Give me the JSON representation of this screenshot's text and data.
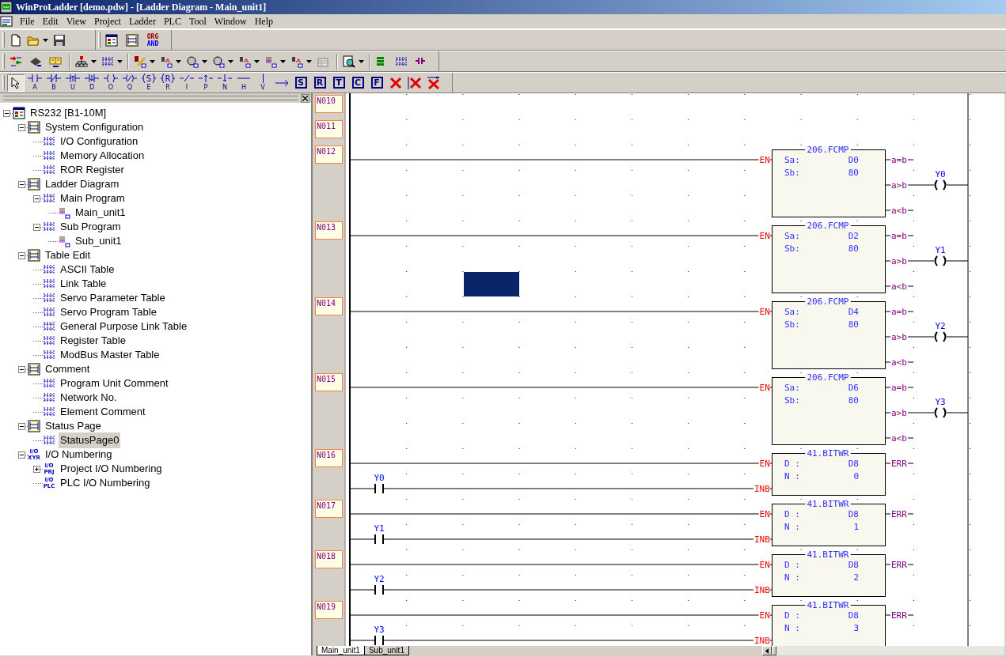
{
  "window": {
    "title": "WinProLadder [demo.pdw] - [Ladder Diagram - Main_unit1]"
  },
  "menu": [
    "File",
    "Edit",
    "View",
    "Project",
    "Ladder",
    "PLC",
    "Tool",
    "Window",
    "Help"
  ],
  "toolbar": {
    "org_and": [
      "ORG",
      "AND"
    ]
  },
  "ladder_tools": [
    {
      "kind": "pointer",
      "selected": true
    },
    {
      "kind": "contact",
      "key": "A",
      "selected": false
    },
    {
      "kind": "contact-nc",
      "key": "B",
      "selected": false
    },
    {
      "kind": "contact-up",
      "key": "U",
      "selected": false
    },
    {
      "kind": "contact-down",
      "key": "D",
      "selected": false
    },
    {
      "kind": "coil",
      "key": "O",
      "selected": false
    },
    {
      "kind": "coil-neg",
      "key": "Q",
      "selected": false
    },
    {
      "kind": "coil-letter",
      "inner": "S",
      "key": "E",
      "selected": false
    },
    {
      "kind": "coil-letter",
      "inner": "R",
      "key": "R",
      "selected": false
    },
    {
      "kind": "invert",
      "key": "I",
      "selected": false
    },
    {
      "kind": "up",
      "key": "P",
      "selected": false
    },
    {
      "kind": "down",
      "key": "N",
      "selected": false
    },
    {
      "kind": "hline",
      "key": "H",
      "selected": false
    },
    {
      "kind": "vline",
      "key": "V",
      "selected": false
    },
    {
      "kind": "arrow",
      "selected": false
    },
    {
      "kind": "boxed",
      "label": "S",
      "selected": false
    },
    {
      "kind": "boxed",
      "label": "R",
      "selected": false
    },
    {
      "kind": "boxed",
      "label": "T",
      "selected": false
    },
    {
      "kind": "boxed",
      "label": "C",
      "selected": false
    },
    {
      "kind": "boxed",
      "label": "F",
      "selected": false
    },
    {
      "kind": "delete",
      "selected": false
    },
    {
      "kind": "delete-v",
      "selected": false
    },
    {
      "kind": "delete-h",
      "selected": false
    }
  ],
  "tree": [
    {
      "label": "RS232 [B1-10M]",
      "expanded": true,
      "selected": false,
      "children": [
        {
          "label": "System Configuration",
          "expanded": true,
          "selected": false,
          "children": [
            {
              "label": "I/O Configuration",
              "selected": false
            },
            {
              "label": "Memory Allocation",
              "selected": false
            },
            {
              "label": "ROR Register",
              "selected": false
            }
          ]
        },
        {
          "label": "Ladder Diagram",
          "expanded": true,
          "selected": false,
          "children": [
            {
              "label": "Main Program",
              "expanded": true,
              "selected": false,
              "children": [
                {
                  "label": "Main_unit1",
                  "selected": false
                }
              ]
            },
            {
              "label": "Sub Program",
              "expanded": true,
              "selected": false,
              "children": [
                {
                  "label": "Sub_unit1",
                  "selected": false
                }
              ]
            }
          ]
        },
        {
          "label": "Table Edit",
          "expanded": true,
          "selected": false,
          "children": [
            {
              "label": "ASCII Table",
              "selected": false
            },
            {
              "label": "Link Table",
              "selected": false
            },
            {
              "label": "Servo Parameter Table",
              "selected": false
            },
            {
              "label": "Servo Program Table",
              "selected": false
            },
            {
              "label": "General Purpose Link Table",
              "selected": false
            },
            {
              "label": "Register Table",
              "selected": false
            },
            {
              "label": "ModBus Master Table",
              "selected": false
            }
          ]
        },
        {
          "label": "Comment",
          "expanded": true,
          "selected": false,
          "children": [
            {
              "label": "Program Unit Comment",
              "selected": false
            },
            {
              "label": "Network No.",
              "selected": false
            },
            {
              "label": "Element Comment",
              "selected": false
            }
          ]
        },
        {
          "label": "Status Page",
          "expanded": true,
          "selected": false,
          "children": [
            {
              "label": "StatusPage0",
              "selected": true
            }
          ]
        },
        {
          "label": "I/O Numbering",
          "badge": [
            "I/O",
            "XYR"
          ],
          "expanded": true,
          "selected": false,
          "children": [
            {
              "label": "Project I/O Numbering",
              "badge": [
                "I/O",
                "PRJ"
              ],
              "expanded": false,
              "selected": false
            },
            {
              "label": "PLC I/O Numbering",
              "badge": [
                "I/O",
                "PLC"
              ],
              "selected": false
            }
          ]
        }
      ]
    }
  ],
  "ladder": {
    "selection": true,
    "networks": [
      {
        "label": "N010",
        "kind": "empty"
      },
      {
        "label": "N011",
        "kind": "empty"
      },
      {
        "label": "N012",
        "kind": "block",
        "block": "206.FCMP",
        "inputs": [
          {
            "pin": "EN"
          }
        ],
        "operands": [
          {
            "name": "Sa:",
            "value": "D0"
          },
          {
            "name": "Sb:",
            "value": "80"
          }
        ],
        "outputs": [
          {
            "label": "a=b"
          },
          {
            "label": "a>b",
            "coil": "Y0"
          },
          {
            "label": "a<b"
          }
        ]
      },
      {
        "label": "N013",
        "kind": "block",
        "block": "206.FCMP",
        "inputs": [
          {
            "pin": "EN"
          }
        ],
        "operands": [
          {
            "name": "Sa:",
            "value": "D2"
          },
          {
            "name": "Sb:",
            "value": "80"
          }
        ],
        "outputs": [
          {
            "label": "a=b"
          },
          {
            "label": "a>b",
            "coil": "Y1"
          },
          {
            "label": "a<b"
          }
        ]
      },
      {
        "label": "N014",
        "kind": "block",
        "block": "206.FCMP",
        "inputs": [
          {
            "pin": "EN"
          }
        ],
        "operands": [
          {
            "name": "Sa:",
            "value": "D4"
          },
          {
            "name": "Sb:",
            "value": "80"
          }
        ],
        "outputs": [
          {
            "label": "a=b"
          },
          {
            "label": "a>b",
            "coil": "Y2"
          },
          {
            "label": "a<b"
          }
        ]
      },
      {
        "label": "N015",
        "kind": "block",
        "block": "206.FCMP",
        "inputs": [
          {
            "pin": "EN"
          }
        ],
        "operands": [
          {
            "name": "Sa:",
            "value": "D6"
          },
          {
            "name": "Sb:",
            "value": "80"
          }
        ],
        "outputs": [
          {
            "label": "a=b"
          },
          {
            "label": "a>b",
            "coil": "Y3"
          },
          {
            "label": "a<b"
          }
        ]
      },
      {
        "label": "N016",
        "kind": "block",
        "block": "41.BITWR",
        "inputs": [
          {
            "pin": "EN"
          },
          {
            "pin": "INB",
            "contact": "Y0"
          }
        ],
        "operands": [
          {
            "name": "D :",
            "value": "D8"
          },
          {
            "name": "N :",
            "value": "0"
          }
        ],
        "outputs": [
          {
            "label": "ERR"
          }
        ]
      },
      {
        "label": "N017",
        "kind": "block",
        "block": "41.BITWR",
        "inputs": [
          {
            "pin": "EN"
          },
          {
            "pin": "INB",
            "contact": "Y1"
          }
        ],
        "operands": [
          {
            "name": "D :",
            "value": "D8"
          },
          {
            "name": "N :",
            "value": "1"
          }
        ],
        "outputs": [
          {
            "label": "ERR"
          }
        ]
      },
      {
        "label": "N018",
        "kind": "block",
        "block": "41.BITWR",
        "inputs": [
          {
            "pin": "EN"
          },
          {
            "pin": "INB",
            "contact": "Y2"
          }
        ],
        "operands": [
          {
            "name": "D :",
            "value": "D8"
          },
          {
            "name": "N :",
            "value": "2"
          }
        ],
        "outputs": [
          {
            "label": "ERR"
          }
        ]
      },
      {
        "label": "N019",
        "kind": "block",
        "block": "41.BITWR",
        "inputs": [
          {
            "pin": "EN"
          },
          {
            "pin": "INB",
            "contact": "Y3"
          }
        ],
        "operands": [
          {
            "name": "D :",
            "value": "D8"
          },
          {
            "name": "N :",
            "value": "3"
          }
        ],
        "outputs": [
          {
            "label": "ERR"
          }
        ]
      }
    ]
  },
  "sheet_tabs": [
    {
      "label": "Main_unit1",
      "selected": true
    },
    {
      "label": "Sub_unit1",
      "selected": false
    }
  ]
}
